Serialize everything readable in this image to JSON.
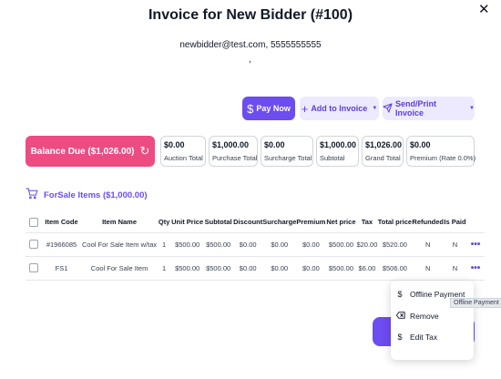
{
  "header": {
    "title": "Invoice for New Bidder (#100)",
    "contact": "newbidder@test.com, 5555555555",
    "sub": ","
  },
  "actions": {
    "pay_now": "Pay Now",
    "add_to_invoice": "Add to Invoice",
    "send_print": "Send/Print Invoice"
  },
  "balance": "Balance Due ($1,026.00)",
  "stats": [
    {
      "value": "$0.00",
      "label": "Auction Total"
    },
    {
      "value": "$1,000.00",
      "label": "Purchase Total"
    },
    {
      "value": "$0.00",
      "label": "Surcharge Total"
    },
    {
      "value": "$1,000.00",
      "label": "Subtotal"
    },
    {
      "value": "$1,026.00",
      "label": "Grand Total"
    },
    {
      "value": "$0.00",
      "label": "Premium (Rate 0.0%)"
    }
  ],
  "section_title": "ForSale Items ($1,000.00)",
  "table": {
    "headers": [
      "Item Code",
      "Item Name",
      "Qty",
      "Unit Price",
      "Subtotal",
      "Discount",
      "Surcharge",
      "Premium",
      "Net price",
      "Tax",
      "Total price",
      "Refunded",
      "Is Paid"
    ],
    "rows": [
      [
        "#1966085",
        "Cool For Sale Item w/tax",
        "1",
        "$500.00",
        "$500.00",
        "$0.00",
        "$0.00",
        "$0.00",
        "$500.00",
        "$20.00",
        "$520.00",
        "N",
        "N"
      ],
      [
        "FS1",
        "Cool For Sale Item",
        "1",
        "$500.00",
        "$500.00",
        "$0.00",
        "$0.00",
        "$0.00",
        "$500.00",
        "$6.00",
        "$506.00",
        "N",
        "N"
      ]
    ]
  },
  "menu": {
    "offline_payment": "Offline Payment",
    "remove": "Remove",
    "edit_tax": "Edit Tax"
  },
  "tooltip": "Offline Payment",
  "colors": {
    "accent": "#6d4cf0",
    "accent_soft": "#ede9fe",
    "balance": "#ec4c82"
  }
}
